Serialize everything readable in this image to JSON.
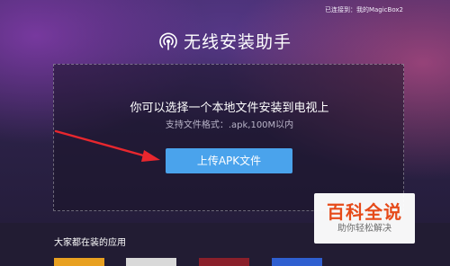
{
  "status": {
    "connected_text": "已连接到：我的MagicBox2"
  },
  "header": {
    "icon": "wifi-signal-icon",
    "title": "无线安装助手"
  },
  "upload_panel": {
    "main_text": "你可以选择一个本地文件安装到电视上",
    "sub_text": "支持文件格式：.apk,100M以内",
    "button_label": "上传APK文件"
  },
  "apps_section": {
    "title": "大家都在装的应用"
  },
  "watermark": {
    "title": "百科全说",
    "subtitle": "助你轻松解决"
  },
  "colors": {
    "button": "#4aa3ec",
    "arrow": "#e8272e",
    "watermark_title": "#e64a19"
  }
}
